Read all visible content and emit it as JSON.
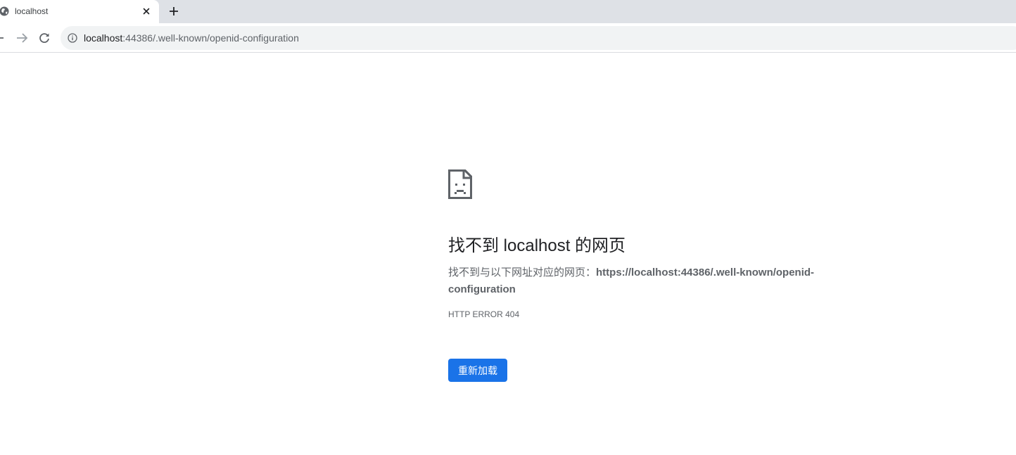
{
  "tab": {
    "title": "localhost",
    "favicon_icon": "globe-icon",
    "close_icon": "close-icon"
  },
  "new_tab_icon": "plus-icon",
  "toolbar": {
    "back_icon": "back-arrow-icon",
    "forward_icon": "forward-arrow-icon",
    "reload_icon": "reload-icon",
    "site_info_icon": "info-icon",
    "url_host": "localhost",
    "url_path": ":44386/.well-known/openid-configuration"
  },
  "error_page": {
    "icon": "sad-page-icon",
    "heading": "找不到 localhost 的网页",
    "description_prefix": "找不到与以下网址对应的网页：",
    "requested_url": "https://localhost:44386/.well-known/openid-configuration",
    "error_code": "HTTP ERROR 404",
    "reload_button_label": "重新加载"
  },
  "colors": {
    "accent": "#1a73e8",
    "tabstrip_bg": "#dee1e6",
    "omnibox_bg": "#f1f3f4",
    "heading_text": "#202124",
    "secondary_text": "#5f6368"
  }
}
